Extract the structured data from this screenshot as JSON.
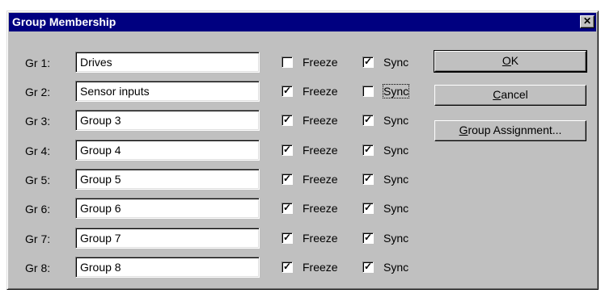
{
  "window": {
    "title": "Group Membership",
    "close_glyph": "✕"
  },
  "groups": [
    {
      "label": "Gr 1:",
      "name": "Drives",
      "freeze": false,
      "sync": true
    },
    {
      "label": "Gr 2:",
      "name": "Sensor inputs",
      "freeze": true,
      "sync": false
    },
    {
      "label": "Gr 3:",
      "name": "Group 3",
      "freeze": true,
      "sync": true
    },
    {
      "label": "Gr 4:",
      "name": "Group 4",
      "freeze": true,
      "sync": true
    },
    {
      "label": "Gr 5:",
      "name": "Group 5",
      "freeze": true,
      "sync": true
    },
    {
      "label": "Gr 6:",
      "name": "Group 6",
      "freeze": true,
      "sync": true
    },
    {
      "label": "Gr 7:",
      "name": "Group 7",
      "freeze": true,
      "sync": true
    },
    {
      "label": "Gr 8:",
      "name": "Group 8",
      "freeze": true,
      "sync": true
    }
  ],
  "labels": {
    "freeze": "Freeze",
    "sync": "Sync"
  },
  "buttons": {
    "ok": {
      "mnemonic": "O",
      "rest": "K"
    },
    "cancel": {
      "mnemonic": "C",
      "rest": "ancel"
    },
    "group_assignment": {
      "mnemonic": "G",
      "rest": "roup Assignment..."
    }
  },
  "check_glyph": "✓"
}
